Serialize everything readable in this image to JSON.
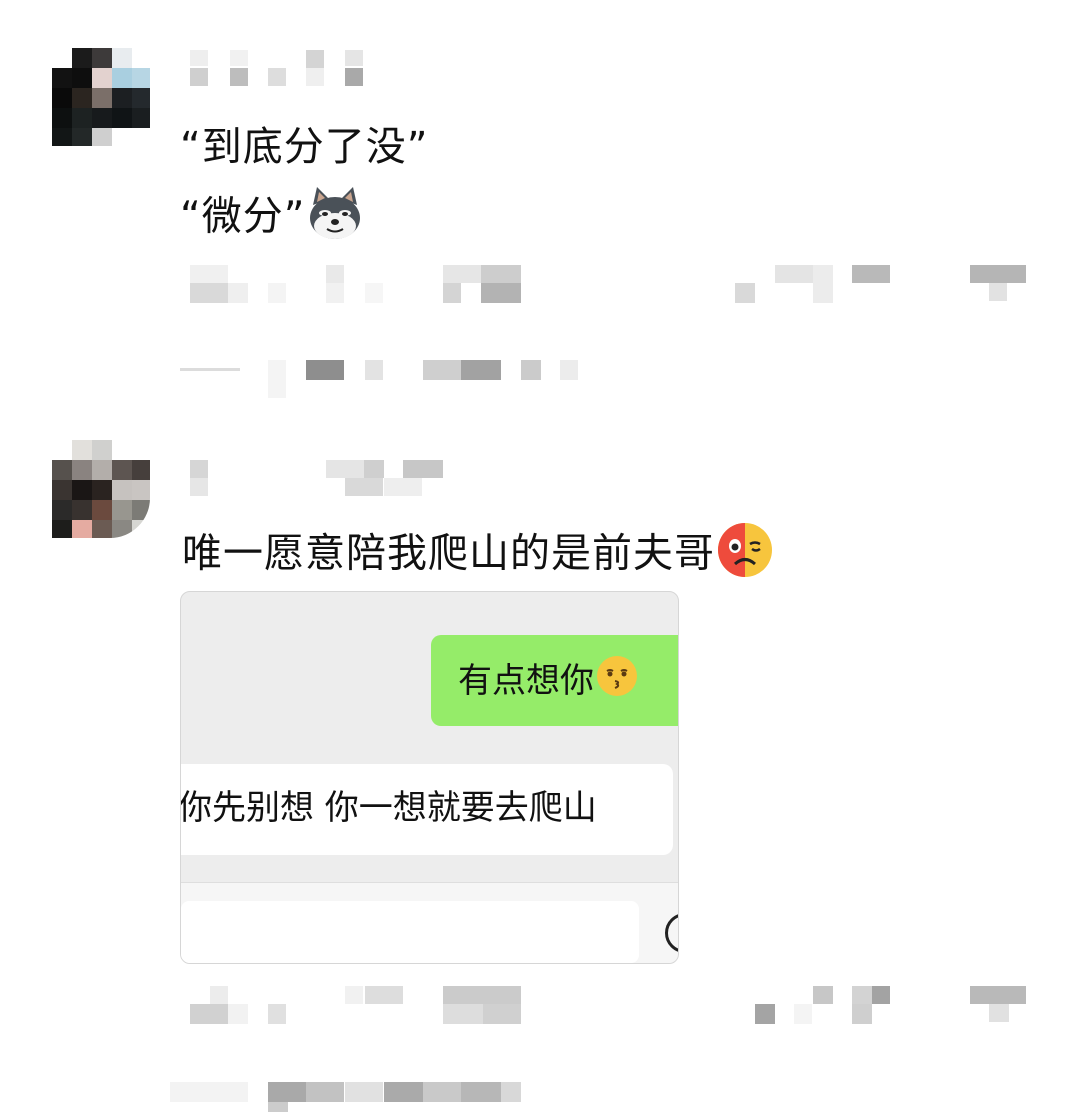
{
  "messages": [
    {
      "id": "comment-1",
      "lines": [
        "“到底分了没”",
        "“微分”"
      ],
      "line2_emoji": "doge-dog-emoji"
    },
    {
      "id": "comment-2",
      "text": "唯一愿意陪我爬山的是前夫哥",
      "emoji": "weary-flushed-face-emoji"
    }
  ],
  "embedded_chat": {
    "sent_message": "有点想你",
    "sent_emoji": "kissing-face-emoji",
    "received_message": "你先别想 你一想就要去爬山"
  },
  "colors": {
    "sent_bubble": "#95ec69",
    "received_bubble": "#ffffff",
    "chat_background": "#ededed",
    "page_background": "#ffffff"
  }
}
